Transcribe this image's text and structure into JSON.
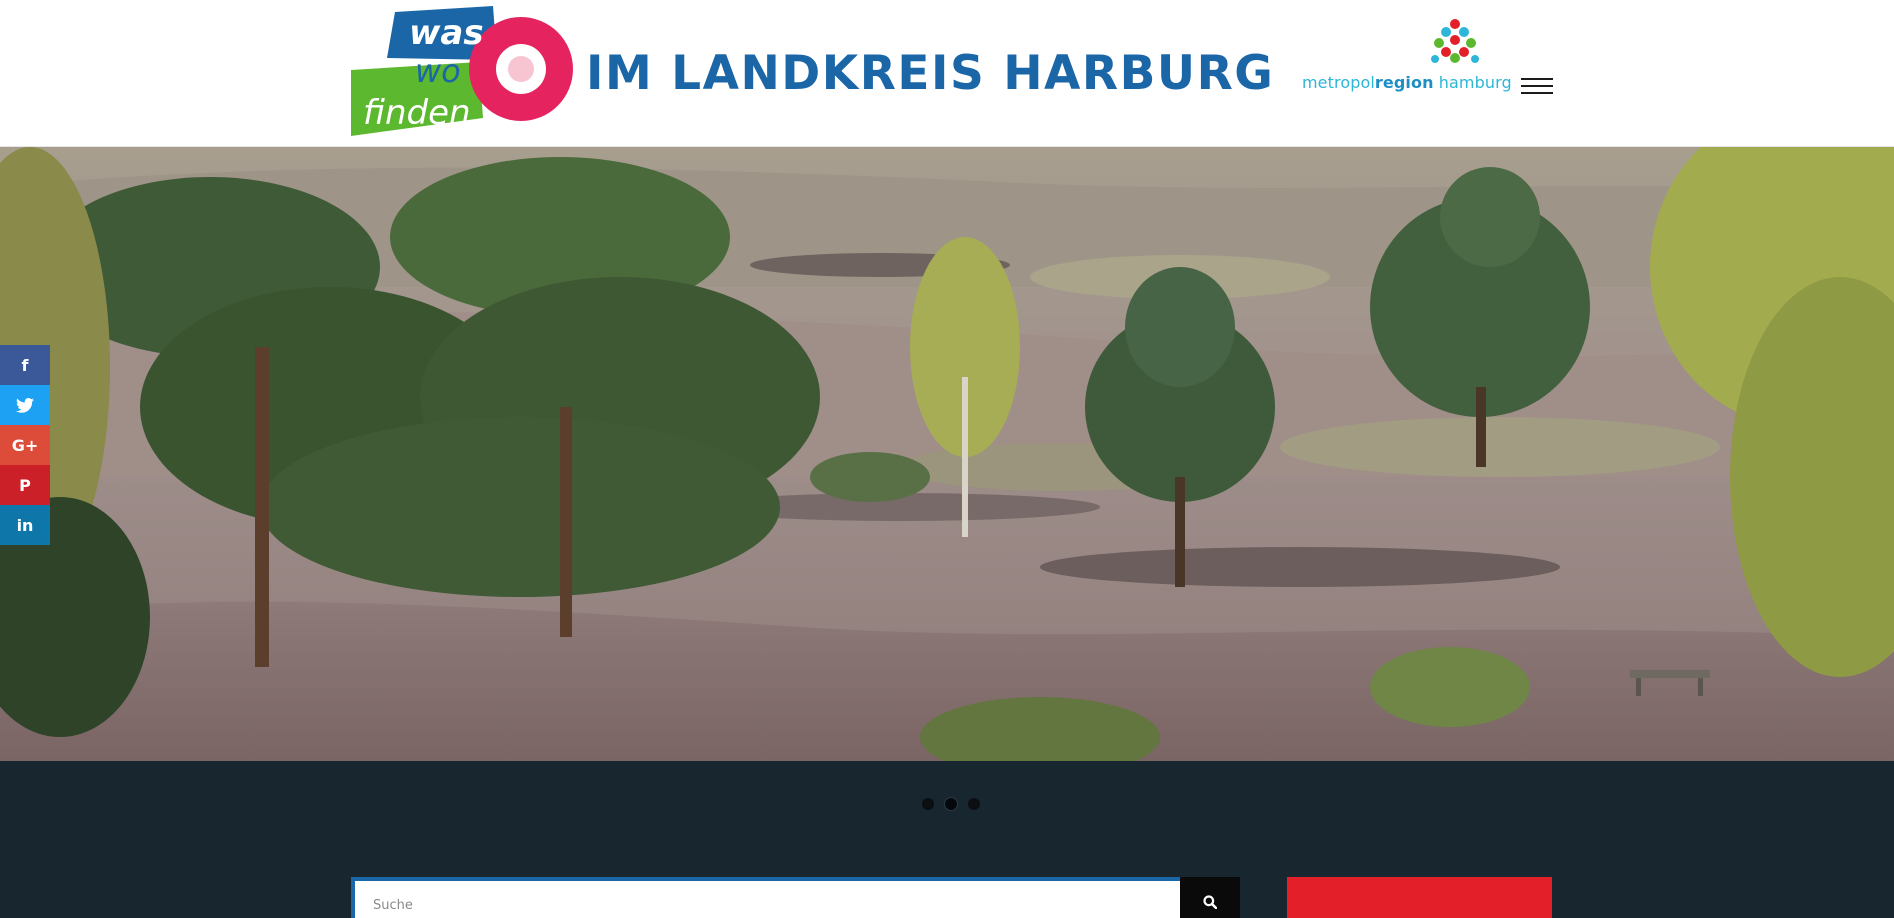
{
  "header": {
    "logo": {
      "mark_words": [
        "was",
        "wo",
        "finden"
      ],
      "tagline": "IM LANDKREIS HARBURG",
      "icon": "compass-logo-icon"
    },
    "partner": {
      "name_prefix": "metropol",
      "name_bold": "region",
      "name_suffix": " hamburg",
      "icon": "metropolregion-symbol-icon"
    },
    "menu": {
      "icon": "hamburger-menu-icon"
    }
  },
  "hero": {
    "slide_description_icon": "heathland-landscape-image",
    "slides_count": 3,
    "active_slide": 2
  },
  "social": {
    "items": [
      {
        "network": "facebook",
        "glyph": "f",
        "color": "#3b5998"
      },
      {
        "network": "twitter",
        "glyph": "🐦",
        "color": "#1da1f2"
      },
      {
        "network": "google-plus",
        "glyph": "G+",
        "color": "#dd4b39"
      },
      {
        "network": "pinterest",
        "glyph": "P",
        "color": "#cb2027"
      },
      {
        "network": "linkedin",
        "glyph": "in",
        "color": "#0e76a8"
      }
    ]
  },
  "search": {
    "placeholder": "Suche",
    "value": "",
    "button_icon": "search-icon"
  },
  "colors": {
    "brand_blue": "#1b66a7",
    "brand_pink": "#e5245f",
    "brand_green": "#5cb82e",
    "band_dark": "#182630",
    "accent_red": "#e3202a"
  }
}
